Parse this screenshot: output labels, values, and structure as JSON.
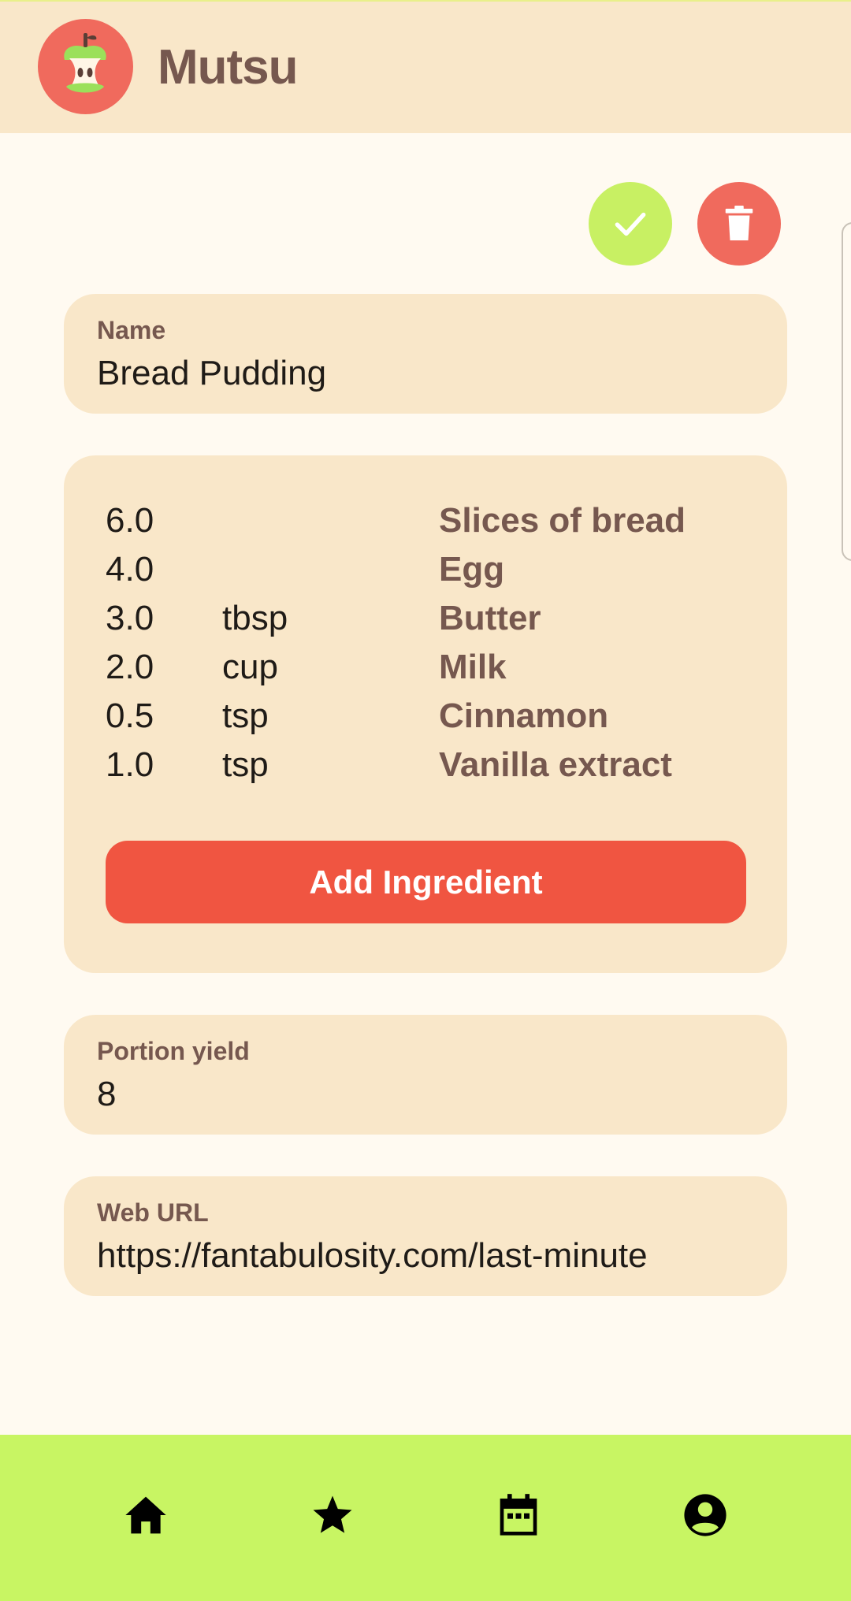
{
  "app": {
    "title": "Mutsu",
    "logo_icon": "apple-core-icon"
  },
  "actions": {
    "save_icon": "checkmark-icon",
    "delete_icon": "trash-icon"
  },
  "form": {
    "name": {
      "label": "Name",
      "value": "Bread Pudding"
    },
    "ingredients": [
      {
        "qty": "6.0",
        "unit": "",
        "name": "Slices of bread"
      },
      {
        "qty": "4.0",
        "unit": "",
        "name": "Egg"
      },
      {
        "qty": "3.0",
        "unit": "tbsp",
        "name": "Butter"
      },
      {
        "qty": "2.0",
        "unit": "cup",
        "name": "Milk"
      },
      {
        "qty": "0.5",
        "unit": "tsp",
        "name": "Cinnamon"
      },
      {
        "qty": "1.0",
        "unit": "tsp",
        "name": "Vanilla extract"
      }
    ],
    "add_ingredient_label": "Add Ingredient",
    "portion_yield": {
      "label": "Portion yield",
      "value": "8"
    },
    "web_url": {
      "label": "Web URL",
      "value": "https://fantabulosity.com/last-minute"
    }
  },
  "nav": [
    {
      "icon": "home-icon"
    },
    {
      "icon": "star-icon"
    },
    {
      "icon": "calendar-icon"
    },
    {
      "icon": "account-circle-icon"
    }
  ],
  "colors": {
    "header_bg": "#F9E7C9",
    "page_bg": "#FFFAF1",
    "card_bg": "#F9E7C9",
    "accent_red": "#F05541",
    "accent_green": "#C8F063",
    "brown_text": "#76584F",
    "nav_bg": "#C8F563"
  }
}
